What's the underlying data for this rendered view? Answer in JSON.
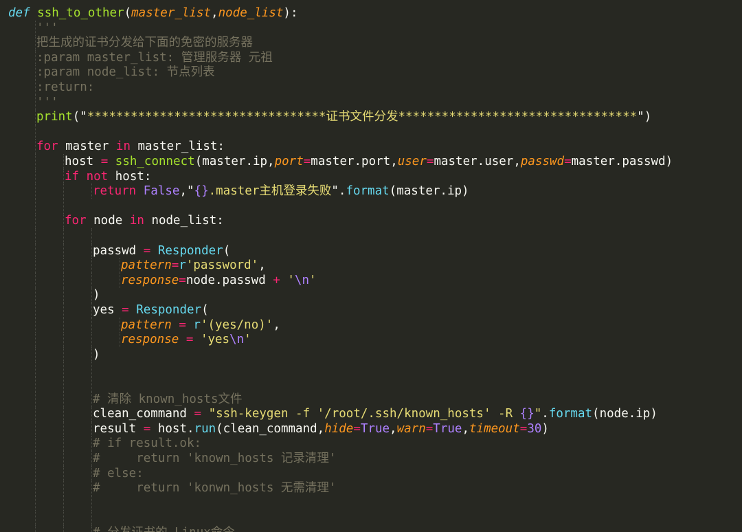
{
  "editor": {
    "theme_colors": {
      "background": "#272822",
      "keyword": "#f92672",
      "function": "#a6e22e",
      "builtin": "#66d9ef",
      "parameter": "#fd971f",
      "string": "#e6db74",
      "number": "#ae81ff",
      "comment": "#75715e",
      "plain": "#f8f8f2"
    },
    "lines": [
      {
        "indent": 0,
        "tokens": [
          {
            "t": "def",
            "c": "def"
          },
          {
            "t": " ",
            "c": "plain"
          },
          {
            "t": "ssh_to_other",
            "c": "fn"
          },
          {
            "t": "(",
            "c": "plain"
          },
          {
            "t": "master_list",
            "c": "param"
          },
          {
            "t": ",",
            "c": "plain"
          },
          {
            "t": "node_list",
            "c": "param"
          },
          {
            "t": "):",
            "c": "plain"
          }
        ]
      },
      {
        "indent": 1,
        "tokens": [
          {
            "t": "'''",
            "c": "comment"
          }
        ]
      },
      {
        "indent": 1,
        "tokens": [
          {
            "t": "把生成的证书分发给下面的免密的服务器",
            "c": "comment"
          }
        ]
      },
      {
        "indent": 1,
        "tokens": [
          {
            "t": ":param master_list: 管理服务器 元祖",
            "c": "comment"
          }
        ]
      },
      {
        "indent": 1,
        "tokens": [
          {
            "t": ":param node_list: 节点列表",
            "c": "comment"
          }
        ]
      },
      {
        "indent": 1,
        "tokens": [
          {
            "t": ":return:",
            "c": "comment"
          }
        ]
      },
      {
        "indent": 1,
        "tokens": [
          {
            "t": "'''",
            "c": "comment"
          }
        ]
      },
      {
        "indent": 1,
        "tokens": [
          {
            "t": "print",
            "c": "fn"
          },
          {
            "t": "(",
            "c": "plain"
          },
          {
            "t": "\"",
            "c": "plain"
          },
          {
            "t": "*********************************证书文件分发*********************************",
            "c": "str"
          },
          {
            "t": "\")",
            "c": "plain"
          }
        ]
      },
      {
        "indent": 1,
        "tokens": []
      },
      {
        "indent": 1,
        "tokens": [
          {
            "t": "for",
            "c": "kw"
          },
          {
            "t": " master ",
            "c": "plain"
          },
          {
            "t": "in",
            "c": "kw"
          },
          {
            "t": " master_list:",
            "c": "plain"
          }
        ]
      },
      {
        "indent": 2,
        "tokens": [
          {
            "t": "host ",
            "c": "plain"
          },
          {
            "t": "=",
            "c": "kw"
          },
          {
            "t": " ",
            "c": "plain"
          },
          {
            "t": "ssh_connect",
            "c": "fn"
          },
          {
            "t": "(master.ip,",
            "c": "plain"
          },
          {
            "t": "port",
            "c": "param"
          },
          {
            "t": "=",
            "c": "kw"
          },
          {
            "t": "master.port,",
            "c": "plain"
          },
          {
            "t": "user",
            "c": "param"
          },
          {
            "t": "=",
            "c": "kw"
          },
          {
            "t": "master.user,",
            "c": "plain"
          },
          {
            "t": "passwd",
            "c": "param"
          },
          {
            "t": "=",
            "c": "kw"
          },
          {
            "t": "master.passwd)",
            "c": "plain"
          }
        ]
      },
      {
        "indent": 2,
        "tokens": [
          {
            "t": "if not",
            "c": "kw"
          },
          {
            "t": " host:",
            "c": "plain"
          }
        ]
      },
      {
        "indent": 3,
        "tokens": [
          {
            "t": "return",
            "c": "kw"
          },
          {
            "t": " ",
            "c": "plain"
          },
          {
            "t": "False",
            "c": "num"
          },
          {
            "t": ",\"",
            "c": "plain"
          },
          {
            "t": "{}",
            "c": "esc"
          },
          {
            "t": ".master主机登录失败",
            "c": "str"
          },
          {
            "t": "\".",
            "c": "plain"
          },
          {
            "t": "format",
            "c": "builtin"
          },
          {
            "t": "(master.ip)",
            "c": "plain"
          }
        ]
      },
      {
        "indent": 2,
        "tokens": []
      },
      {
        "indent": 2,
        "tokens": [
          {
            "t": "for",
            "c": "kw"
          },
          {
            "t": " node ",
            "c": "plain"
          },
          {
            "t": "in",
            "c": "kw"
          },
          {
            "t": " node_list:",
            "c": "plain"
          }
        ]
      },
      {
        "indent": 3,
        "tokens": []
      },
      {
        "indent": 3,
        "tokens": [
          {
            "t": "passwd ",
            "c": "plain"
          },
          {
            "t": "=",
            "c": "kw"
          },
          {
            "t": " ",
            "c": "plain"
          },
          {
            "t": "Responder",
            "c": "builtin"
          },
          {
            "t": "(",
            "c": "plain"
          }
        ]
      },
      {
        "indent": 4,
        "tokens": [
          {
            "t": "pattern",
            "c": "param"
          },
          {
            "t": "=",
            "c": "kw"
          },
          {
            "t": "r",
            "c": "builtin"
          },
          {
            "t": "'password'",
            "c": "str"
          },
          {
            "t": ",",
            "c": "plain"
          }
        ]
      },
      {
        "indent": 4,
        "tokens": [
          {
            "t": "response",
            "c": "param"
          },
          {
            "t": "=",
            "c": "kw"
          },
          {
            "t": "node.passwd ",
            "c": "plain"
          },
          {
            "t": "+",
            "c": "kw"
          },
          {
            "t": " ",
            "c": "plain"
          },
          {
            "t": "'",
            "c": "str"
          },
          {
            "t": "\\n",
            "c": "esc"
          },
          {
            "t": "'",
            "c": "str"
          }
        ]
      },
      {
        "indent": 3,
        "tokens": [
          {
            "t": ")",
            "c": "plain"
          }
        ]
      },
      {
        "indent": 3,
        "tokens": [
          {
            "t": "yes ",
            "c": "plain"
          },
          {
            "t": "=",
            "c": "kw"
          },
          {
            "t": " ",
            "c": "plain"
          },
          {
            "t": "Responder",
            "c": "builtin"
          },
          {
            "t": "(",
            "c": "plain"
          }
        ]
      },
      {
        "indent": 4,
        "tokens": [
          {
            "t": "pattern",
            "c": "param"
          },
          {
            "t": " ",
            "c": "plain"
          },
          {
            "t": "=",
            "c": "kw"
          },
          {
            "t": " ",
            "c": "plain"
          },
          {
            "t": "r",
            "c": "builtin"
          },
          {
            "t": "'(yes/no)'",
            "c": "str"
          },
          {
            "t": ",",
            "c": "plain"
          }
        ]
      },
      {
        "indent": 4,
        "tokens": [
          {
            "t": "response",
            "c": "param"
          },
          {
            "t": " ",
            "c": "plain"
          },
          {
            "t": "=",
            "c": "kw"
          },
          {
            "t": " ",
            "c": "plain"
          },
          {
            "t": "'yes",
            "c": "str"
          },
          {
            "t": "\\n",
            "c": "esc"
          },
          {
            "t": "'",
            "c": "str"
          }
        ]
      },
      {
        "indent": 3,
        "tokens": [
          {
            "t": ")",
            "c": "plain"
          }
        ]
      },
      {
        "indent": 3,
        "tokens": []
      },
      {
        "indent": 3,
        "tokens": []
      },
      {
        "indent": 3,
        "tokens": [
          {
            "t": "# 清除 known_hosts文件",
            "c": "comment"
          }
        ]
      },
      {
        "indent": 3,
        "tokens": [
          {
            "t": "clean_command ",
            "c": "plain"
          },
          {
            "t": "=",
            "c": "kw"
          },
          {
            "t": " ",
            "c": "plain"
          },
          {
            "t": "\"ssh-keygen -f '/root/.ssh/known_hosts' -R ",
            "c": "str"
          },
          {
            "t": "{}",
            "c": "esc"
          },
          {
            "t": "\"",
            "c": "str"
          },
          {
            "t": ".",
            "c": "plain"
          },
          {
            "t": "format",
            "c": "builtin"
          },
          {
            "t": "(node.ip)",
            "c": "plain"
          }
        ]
      },
      {
        "indent": 3,
        "tokens": [
          {
            "t": "result ",
            "c": "plain"
          },
          {
            "t": "=",
            "c": "kw"
          },
          {
            "t": " host.",
            "c": "plain"
          },
          {
            "t": "run",
            "c": "builtin"
          },
          {
            "t": "(clean_command,",
            "c": "plain"
          },
          {
            "t": "hide",
            "c": "param"
          },
          {
            "t": "=",
            "c": "kw"
          },
          {
            "t": "True",
            "c": "num"
          },
          {
            "t": ",",
            "c": "plain"
          },
          {
            "t": "warn",
            "c": "param"
          },
          {
            "t": "=",
            "c": "kw"
          },
          {
            "t": "True",
            "c": "num"
          },
          {
            "t": ",",
            "c": "plain"
          },
          {
            "t": "timeout",
            "c": "param"
          },
          {
            "t": "=",
            "c": "kw"
          },
          {
            "t": "30",
            "c": "num"
          },
          {
            "t": ")",
            "c": "plain"
          }
        ]
      },
      {
        "indent": 3,
        "tokens": [
          {
            "t": "# if result.ok:",
            "c": "comment"
          }
        ]
      },
      {
        "indent": 3,
        "tokens": [
          {
            "t": "#     return 'known_hosts 记录清理'",
            "c": "comment"
          }
        ]
      },
      {
        "indent": 3,
        "tokens": [
          {
            "t": "# else:",
            "c": "comment"
          }
        ]
      },
      {
        "indent": 3,
        "tokens": [
          {
            "t": "#     return 'konwn_hosts 无需清理'",
            "c": "comment"
          }
        ]
      },
      {
        "indent": 3,
        "tokens": []
      },
      {
        "indent": 3,
        "tokens": []
      },
      {
        "indent": 3,
        "tokens": [
          {
            "t": "# 分发证书的 Linux命令",
            "c": "comment"
          }
        ]
      }
    ]
  }
}
